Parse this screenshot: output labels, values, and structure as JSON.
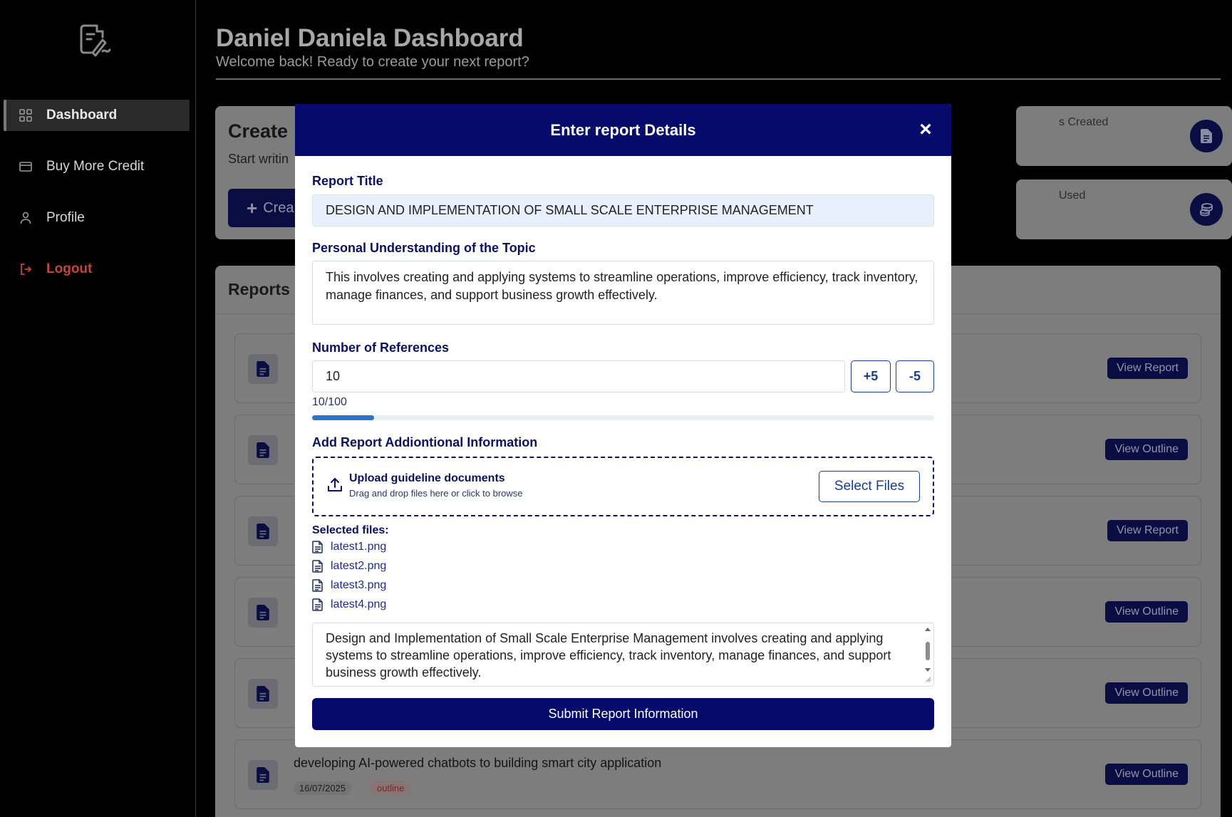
{
  "sidebar": {
    "items": [
      {
        "label": "Dashboard",
        "icon": "grid-icon"
      },
      {
        "label": "Buy More Credit",
        "icon": "card-icon"
      },
      {
        "label": "Profile",
        "icon": "user-icon"
      },
      {
        "label": "Logout",
        "icon": "logout-icon"
      }
    ]
  },
  "header": {
    "title": "Daniel Daniela Dashboard",
    "subtitle": "Welcome back! Ready to create your next report?"
  },
  "create_card": {
    "title": "Create",
    "subtitle": "Start writin",
    "button_label": "Crea"
  },
  "stats": [
    {
      "label": "s Created"
    },
    {
      "label": "Used"
    }
  ],
  "reports": {
    "title": "Reports",
    "rows": [
      {
        "title": "",
        "date": "",
        "tag": "",
        "button": "View Report"
      },
      {
        "title": "",
        "date": "",
        "tag": "",
        "button": "View Outline"
      },
      {
        "title": "",
        "date": "",
        "tag": "",
        "button": "View Report"
      },
      {
        "title": "",
        "date": "",
        "tag": "",
        "button": "View Outline"
      },
      {
        "title": "",
        "date": "",
        "tag": "",
        "button": "View Outline"
      },
      {
        "title": "developing AI-powered chatbots to building smart city application",
        "date": "16/07/2025",
        "tag": "outline",
        "button": "View Outline"
      }
    ]
  },
  "modal": {
    "title": "Enter report Details",
    "close": "×",
    "report_title_label": "Report Title",
    "report_title_value": "DESIGN AND IMPLEMENTATION OF SMALL SCALE ENTERPRISE MANAGEMENT",
    "understanding_label": "Personal Understanding of the Topic",
    "understanding_value": "This involves creating and applying systems to streamline operations, improve efficiency, track inventory, manage finances, and support business growth effectively.",
    "references_label": "Number of References",
    "references_value": "10",
    "plus_label": "+5",
    "minus_label": "-5",
    "references_count": "10/100",
    "references_progress": 0.1,
    "additional_label": "Add Report Addiontional Information",
    "upload_title": "Upload guideline documents",
    "upload_sub": "Drag and drop files here or click to browse",
    "select_files_label": "Select Files",
    "selected_files_label": "Selected files:",
    "files": [
      "latest1.png",
      "latest2.png",
      "latest3.png",
      "latest4.png"
    ],
    "notes_value": "Design and Implementation of Small Scale Enterprise Management involves creating and applying systems to streamline operations, improve efficiency, track inventory, manage finances, and support business growth effectively.",
    "submit_label": "Submit Report Information"
  },
  "colors": {
    "navy": "#050a6b",
    "accent_blue": "#2a74c5",
    "logout_red": "#c0473c"
  }
}
